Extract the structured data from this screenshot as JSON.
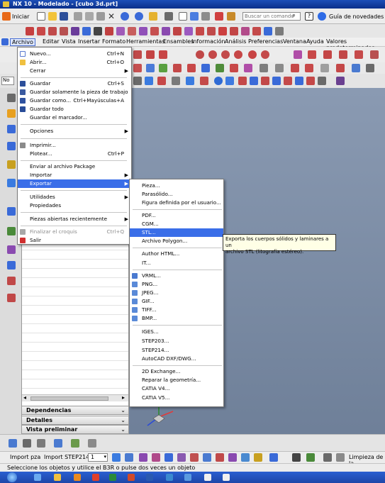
{
  "window": {
    "title": "NX 10 - Modelado - [cubo 3d.prt]"
  },
  "toolbar1": {
    "start_label": "Iniciar",
    "search_placeholder": "Buscar un comando",
    "help_label": "Guía de novedades"
  },
  "menubar": {
    "items": [
      "Archivo",
      "Editar",
      "Vista",
      "Insertar",
      "Formato",
      "Herramientas",
      "Ensambles",
      "Información",
      "Análisis",
      "Preferencias",
      "Ventana",
      "Ayuda",
      "Valores predeterminados"
    ]
  },
  "file_menu": {
    "items": [
      {
        "label": "Nuevo...",
        "shortcut": "Ctrl+N"
      },
      {
        "label": "Abrir...",
        "shortcut": "Ctrl+O"
      },
      {
        "label": "Cerrar",
        "shortcut": ""
      },
      {
        "label": "Guardar",
        "shortcut": "Ctrl+S"
      },
      {
        "label": "Guardar solamente la pieza de trabajo",
        "shortcut": ""
      },
      {
        "label": "Guardar como...",
        "shortcut": "Ctrl+Mayúsculas+A"
      },
      {
        "label": "Guardar todo",
        "shortcut": ""
      },
      {
        "label": "Guardar el marcador...",
        "shortcut": ""
      },
      {
        "label": "Opciones",
        "shortcut": ""
      },
      {
        "label": "Imprimir...",
        "shortcut": ""
      },
      {
        "label": "Plotear...",
        "shortcut": "Ctrl+P"
      },
      {
        "label": "Enviar al archivo Package",
        "shortcut": ""
      },
      {
        "label": "Importar",
        "shortcut": ""
      },
      {
        "label": "Exportar",
        "shortcut": ""
      },
      {
        "label": "Utilidades",
        "shortcut": ""
      },
      {
        "label": "Propiedades",
        "shortcut": ""
      },
      {
        "label": "Piezas abiertas recientemente",
        "shortcut": ""
      },
      {
        "label": "Finalizar el croquis",
        "shortcut": "Ctrl+Q"
      },
      {
        "label": "Salir",
        "shortcut": ""
      }
    ]
  },
  "export_menu": {
    "items": [
      "Pieza...",
      "Parasólido...",
      "Figura definida por el usuario...",
      "PDF...",
      "CGM...",
      "STL...",
      "Archivo Polygon...",
      "Author HTML...",
      "IT...",
      "VRML...",
      "PNG...",
      "JPEG...",
      "GIF...",
      "TIFF...",
      "BMP...",
      "IGES...",
      "STEP203...",
      "STEP214...",
      "AutoCAD DXF/DWG...",
      "2D Exchange...",
      "Reparar la geometría...",
      "CATIA V4...",
      "CATIA V5..."
    ],
    "highlighted": "STL..."
  },
  "tooltip": {
    "line1": "Exporta los cuerpos sólidos y laminares a un",
    "line2": "archivo STL (litografía estéreo)."
  },
  "nav_panel": {
    "sections": [
      "Dependencias",
      "Detalles",
      "Vista preliminar"
    ]
  },
  "bottom_toolbar": {
    "import_label": "Import pza",
    "import_step_label": "Import STEP214",
    "layer_value": "1",
    "cleanup_label": "Limpieza de la"
  },
  "status_bar": {
    "text": "Seleccione los objetos y utilice el B3R o pulse dos veces un objeto"
  }
}
